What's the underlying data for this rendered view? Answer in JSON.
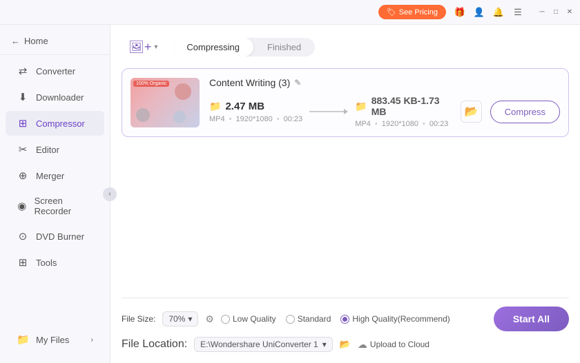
{
  "titlebar": {
    "pricing_label": "See Pricing",
    "icons": [
      "gift",
      "user",
      "bell",
      "menu",
      "minimize",
      "restore",
      "close"
    ]
  },
  "sidebar": {
    "back_label": "Home",
    "items": [
      {
        "id": "converter",
        "label": "Converter",
        "icon": "⇄"
      },
      {
        "id": "downloader",
        "label": "Downloader",
        "icon": "↓"
      },
      {
        "id": "compressor",
        "label": "Compressor",
        "icon": "⊞",
        "active": true
      },
      {
        "id": "editor",
        "label": "Editor",
        "icon": "✂"
      },
      {
        "id": "merger",
        "label": "Merger",
        "icon": "⊕"
      },
      {
        "id": "screen-recorder",
        "label": "Screen Recorder",
        "icon": "◉"
      },
      {
        "id": "dvd-burner",
        "label": "DVD Burner",
        "icon": "⊙"
      },
      {
        "id": "tools",
        "label": "Tools",
        "icon": "⊞"
      }
    ],
    "footer": {
      "my_files": "My Files"
    }
  },
  "header": {
    "add_button_label": "",
    "tabs": [
      {
        "id": "compressing",
        "label": "Compressing",
        "active": true
      },
      {
        "id": "finished",
        "label": "Finished",
        "active": false
      }
    ]
  },
  "file_card": {
    "title": "Content Writing (3)",
    "source": {
      "size": "2.47 MB",
      "format": "MP4",
      "resolution": "1920*1080",
      "duration": "00:23"
    },
    "output": {
      "size": "883.45 KB-1.73 MB",
      "format": "MP4",
      "resolution": "1920*1080",
      "duration": "00:23"
    },
    "compress_btn": "Compress"
  },
  "bottom_bar": {
    "file_size_label": "File Size:",
    "file_size_value": "70%",
    "quality_options": [
      {
        "id": "low",
        "label": "Low Quality",
        "checked": false
      },
      {
        "id": "standard",
        "label": "Standard",
        "checked": false
      },
      {
        "id": "high",
        "label": "High Quality(Recommend)",
        "checked": true
      }
    ],
    "file_location_label": "File Location:",
    "file_location_value": "E:\\Wondershare UniConverter 1",
    "upload_cloud_label": "Upload to Cloud",
    "start_btn": "Start All"
  }
}
